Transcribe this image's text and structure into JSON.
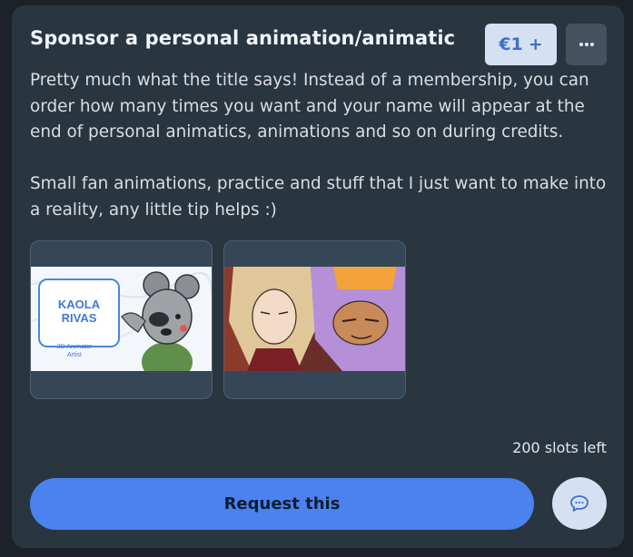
{
  "card": {
    "title": "Sponsor a personal animation/animatic",
    "price": "€1",
    "price_plus": "+",
    "description": [
      "Pretty much what the title says! Instead of a membership, you can order how many times you want and your name will appear at the end of personal animatics, animations and so on during credits.",
      "Small fan animations, practice and stuff that I just want to make into a reality, any little tip helps :)"
    ],
    "thumbnails": [
      {
        "logo_text": "KAOLA RIVAS",
        "caption_line1": "2D Animator",
        "caption_line2": "Artist"
      },
      {}
    ],
    "slots": "200 slots left",
    "request_label": "Request this"
  },
  "icons": {
    "more": "more-dots-icon",
    "chat": "chat-bubble-icon"
  },
  "colors": {
    "card_bg": "#29353f",
    "accent": "#4b82ee",
    "price_bg": "#d5e1f2",
    "price_text": "#3e6fc8"
  }
}
